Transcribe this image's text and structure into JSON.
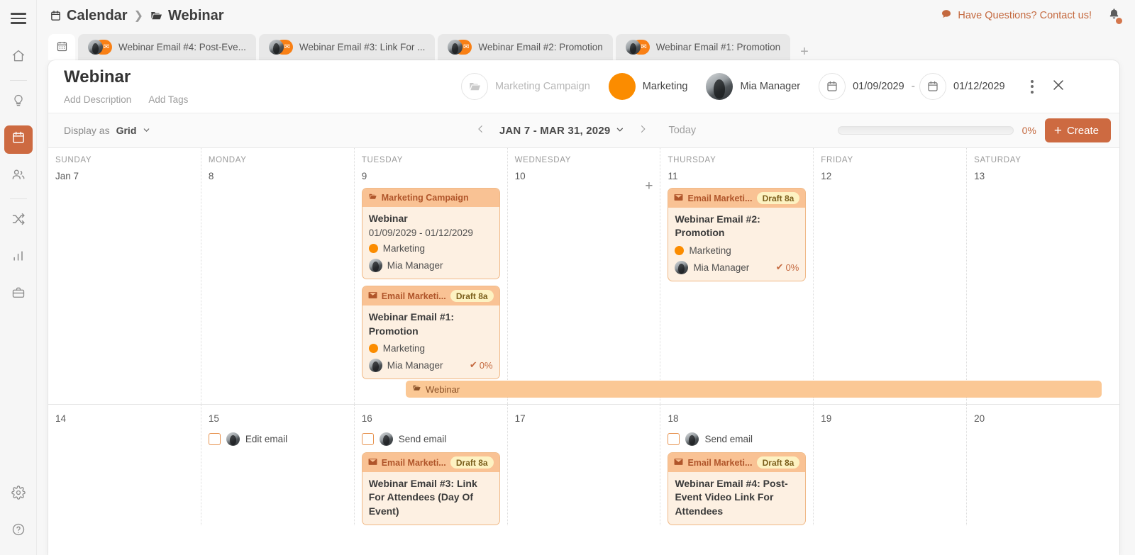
{
  "app": {
    "breadcrumb": {
      "root": "Calendar",
      "current": "Webinar"
    },
    "contact_link": "Have Questions? Contact us!",
    "menu_icon": "hamburger-icon",
    "bell_icon": "notification-bell-icon"
  },
  "sidebar": {
    "items": [
      {
        "icon": "home-icon",
        "name": "home"
      },
      {
        "icon": "lightbulb-icon",
        "name": "ideas"
      },
      {
        "icon": "calendar-icon",
        "name": "calendar",
        "active": true
      },
      {
        "icon": "people-icon",
        "name": "people"
      },
      {
        "icon": "shuffle-icon",
        "name": "workflows"
      },
      {
        "icon": "bar-chart-icon",
        "name": "analytics"
      },
      {
        "icon": "briefcase-icon",
        "name": "assets"
      }
    ],
    "bottom": [
      {
        "icon": "gear-icon",
        "name": "settings"
      },
      {
        "icon": "help-icon",
        "name": "help"
      }
    ]
  },
  "tabs": {
    "home_icon": "calendar-tab-icon",
    "add_label": "+",
    "items": [
      {
        "label": "Webinar Email #4: Post-Eve..."
      },
      {
        "label": "Webinar Email #3: Link For ..."
      },
      {
        "label": "Webinar Email #2: Promotion"
      },
      {
        "label": "Webinar Email #1: Promotion"
      }
    ]
  },
  "panel": {
    "title": "Webinar",
    "add_description": "Add Description",
    "add_tags": "Add Tags",
    "campaign_chip": {
      "icon": "folder-icon",
      "label": "Marketing Campaign"
    },
    "channel_chip": {
      "label": "Marketing",
      "color": "#fb8c00"
    },
    "owner_chip": {
      "label": "Mia Manager",
      "avatar": "user-avatar"
    },
    "start_date": "01/09/2029",
    "date_separator": "-",
    "end_date": "01/12/2029",
    "kebab_label": "More options",
    "close_label": "Close"
  },
  "toolbar": {
    "display_as_label": "Display as",
    "display_as_value": "Grid",
    "prev_label": "Previous",
    "next_label": "Next",
    "range_label": "JAN 7 - MAR 31, 2029",
    "today_label": "Today",
    "progress_pct": "0%",
    "progress_value": 0,
    "create_label": "Create"
  },
  "calendar": {
    "dow": [
      "SUNDAY",
      "MONDAY",
      "TUESDAY",
      "WEDNESDAY",
      "THURSDAY",
      "FRIDAY",
      "SATURDAY"
    ],
    "week1": {
      "days": [
        "Jan 7",
        "8",
        "9",
        "10",
        "11",
        "12",
        "13"
      ],
      "span_bar": {
        "icon": "folder-icon",
        "label": "Webinar"
      }
    },
    "week2": {
      "days": [
        "14",
        "15",
        "16",
        "17",
        "18",
        "19",
        "20"
      ]
    },
    "cards": {
      "campaign": {
        "head_icon": "folder-icon",
        "head_label": "Marketing Campaign",
        "name": "Webinar",
        "dates": "01/09/2029 - 01/12/2029",
        "channel": "Marketing",
        "owner": "Mia Manager"
      },
      "email1": {
        "head_icon": "envelope-icon",
        "head_label": "Email Marketi...",
        "badge": "Draft 8a",
        "name": "Webinar Email #1: Promotion",
        "channel": "Marketing",
        "owner": "Mia Manager",
        "pct": "0%"
      },
      "email2": {
        "head_icon": "envelope-icon",
        "head_label": "Email Marketi...",
        "badge": "Draft 8a",
        "name": "Webinar Email #2: Promotion",
        "channel": "Marketing",
        "owner": "Mia Manager",
        "pct": "0%"
      },
      "email3": {
        "head_icon": "envelope-icon",
        "head_label": "Email Marketi...",
        "badge": "Draft 8a",
        "name": "Webinar Email #3: Link For Attendees (Day Of Event)"
      },
      "email4": {
        "head_icon": "envelope-icon",
        "head_label": "Email Marketi...",
        "badge": "Draft 8a",
        "name": "Webinar Email #4: Post-Event Video Link For Attendees"
      }
    },
    "tasks": {
      "edit_email": "Edit email",
      "send_email_16": "Send email",
      "send_email_18": "Send email"
    }
  },
  "colors": {
    "accent": "#cd6a41",
    "orange": "#fb8c00",
    "card_bg": "#fdf0e2",
    "card_head": "#f9c294",
    "badge_bg": "#fdf2c2"
  }
}
